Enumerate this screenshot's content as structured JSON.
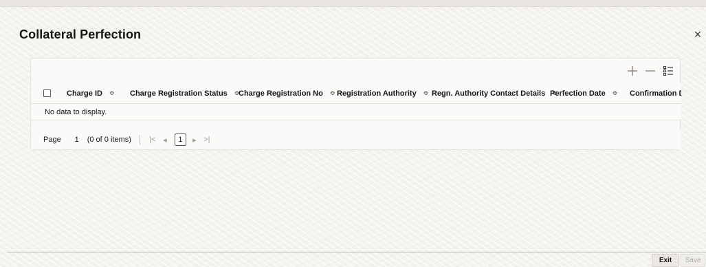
{
  "dialog": {
    "title": "Collateral Perfection",
    "close_glyph": "×"
  },
  "toolbar": {
    "add_icon": "plus-icon",
    "remove_icon": "minus-icon",
    "columns_icon": "column-list-icon"
  },
  "table": {
    "columns": [
      {
        "label": "Charge ID"
      },
      {
        "label": "Charge Registration Status"
      },
      {
        "label": "Charge Registration No"
      },
      {
        "label": "Registration Authority"
      },
      {
        "label": "Regn. Authority Contact Details"
      },
      {
        "label": "Perfection Date"
      },
      {
        "label": "Confirmation Da"
      }
    ],
    "sort_glyph": "≎",
    "empty_message": "No data to display."
  },
  "pager": {
    "label": "Page",
    "current_page": "1",
    "count_text": "(0 of 0 items)",
    "first": "|<",
    "prev": "◂",
    "page_number": "1",
    "next": "▸",
    "last": ">|"
  },
  "footer": {
    "exit_label": "Exit",
    "save_label": "Save"
  }
}
